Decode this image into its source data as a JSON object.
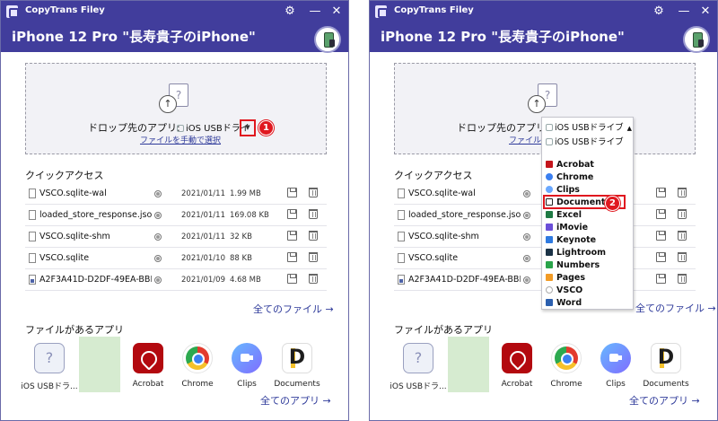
{
  "app_title": "CopyTrans Filey",
  "device_title": "iPhone 12 Pro \"長寿貴子のiPhone\"",
  "titlebar_icons": {
    "settings": "gear-icon",
    "minimize": "minimize-icon",
    "close": "close-icon"
  },
  "drop_zone": {
    "label": "ドロップ先のアプリ:",
    "selected_app": "iOS USBドライブ",
    "selected_app_cut": "iOS USBドライ",
    "manual_link": "ファイルを手動で選択"
  },
  "quick_access": {
    "title": "クイックアクセス",
    "files": [
      {
        "name": "VSCO.sqlite-wal",
        "date": "2021/01/11",
        "size": "1.99 MB",
        "icon": "file-icon"
      },
      {
        "name": "loaded_store_response.json",
        "date": "2021/01/11",
        "size": "169.08 KB",
        "icon": "file-icon"
      },
      {
        "name": "VSCO.sqlite-shm",
        "date": "2021/01/11",
        "size": "32 KB",
        "icon": "file-icon"
      },
      {
        "name": "VSCO.sqlite",
        "date": "2021/01/10",
        "size": "88 KB",
        "icon": "file-icon"
      },
      {
        "name": "A2F3A41D-D2DF-49EA-BBF...",
        "date": "2021/01/09",
        "size": "4.68 MB",
        "icon": "image-file-icon"
      }
    ],
    "all_files_link": "全てのファイル →"
  },
  "apps_with_files": {
    "title": "ファイルがあるアプリ",
    "apps_left": [
      "iOS USBドラ...",
      "",
      "Acrobat",
      "Chrome",
      "Clips",
      "Documents"
    ],
    "apps_right": [
      "iOS USBドラ...",
      "",
      "Acrobat",
      "Chrome",
      "Clips",
      "Documents"
    ],
    "all_apps_link": "全てのアプリ →"
  },
  "dropdown": {
    "header_items": [
      "iOS USBドライブ",
      "iOS USBドライブ"
    ],
    "items": [
      {
        "label": "Acrobat",
        "color": "#c4151c"
      },
      {
        "label": "Chrome",
        "color": "#3b7ff0"
      },
      {
        "label": "Clips",
        "color": "#6aa8ff"
      },
      {
        "label": "Documents",
        "color": "#222222"
      },
      {
        "label": "Excel",
        "color": "#1f7a44"
      },
      {
        "label": "iMovie",
        "color": "#6b4fd8"
      },
      {
        "label": "Keynote",
        "color": "#2f7ae0"
      },
      {
        "label": "Lightroom",
        "color": "#1b3246"
      },
      {
        "label": "Numbers",
        "color": "#2aa44a"
      },
      {
        "label": "Pages",
        "color": "#f29b26"
      },
      {
        "label": "VSCO",
        "color": "#cccccc"
      },
      {
        "label": "Word",
        "color": "#2b5faf"
      }
    ]
  },
  "annotations": {
    "step1": "1",
    "step2": "2"
  },
  "colors": {
    "accent": "#413d9c",
    "highlight": "#e0181f",
    "link": "#2e3a9a"
  }
}
